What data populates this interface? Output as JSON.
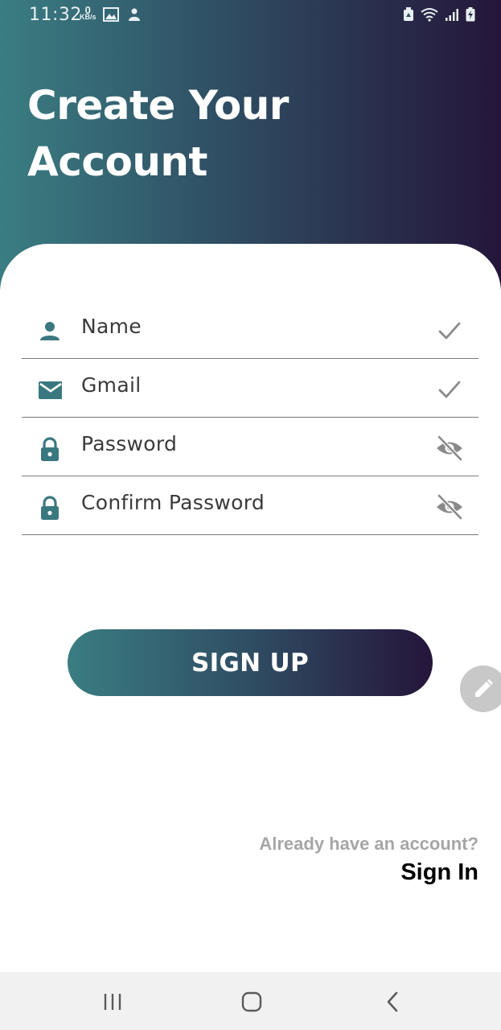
{
  "status_bar": {
    "time": "11:32",
    "net_speed_value": "0",
    "net_speed_unit": "KB/s"
  },
  "header": {
    "title_line1": "Create Your",
    "title_line2": "Account"
  },
  "form": {
    "fields": [
      {
        "label": "Name",
        "icon": "person-icon",
        "trailing_icon": "check-icon"
      },
      {
        "label": "Gmail",
        "icon": "email-icon",
        "trailing_icon": "check-icon"
      },
      {
        "label": "Password",
        "icon": "lock-icon",
        "trailing_icon": "eye-off-icon"
      },
      {
        "label": "Confirm Password",
        "icon": "lock-icon",
        "trailing_icon": "eye-off-icon"
      }
    ],
    "submit_label": "SIGN UP"
  },
  "footer": {
    "prompt": "Already have an account?",
    "link_label": "Sign In"
  },
  "colors": {
    "gradient_start": "#3a7d82",
    "gradient_end": "#24163a",
    "icon_teal": "#3a7880",
    "divider": "#7a7a7a"
  }
}
